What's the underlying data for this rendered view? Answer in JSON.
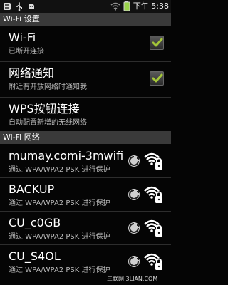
{
  "status_bar": {
    "time": "下午 5:38",
    "usb_label": "USB"
  },
  "wifi_settings_header": "Wi-Fi 设置",
  "wifi_toggle": {
    "title": "Wi-Fi",
    "summary": "已断开连接",
    "checked": true
  },
  "network_notification": {
    "title": "网络通知",
    "summary": "附近有开放网络时通知我",
    "checked": true
  },
  "wps_connection": {
    "title": "WPS按钮连接",
    "summary": "自动配置新增的无线网络"
  },
  "wifi_networks_header": "Wi-Fi 网络",
  "networks": [
    {
      "name": "mumay.comi-3mwifi",
      "security": "通过 WPA/WPA2 PSK 进行保护"
    },
    {
      "name": "BACKUP",
      "security": "通过 WPA/WPA2 PSK 进行保护"
    },
    {
      "name": "CU_c0GB",
      "security": "通过 WPA/WPA2 PSK 进行保护"
    },
    {
      "name": "CU_S4OL",
      "security": "通过 WPA/WPA2 PSK 进行保护"
    }
  ],
  "watermark": "三联网 3LIAN.COM",
  "colors": {
    "checkbox_check": "#a4c639",
    "section_header_bg": "#3a3a3a",
    "summary_text": "#b8b8b8"
  }
}
